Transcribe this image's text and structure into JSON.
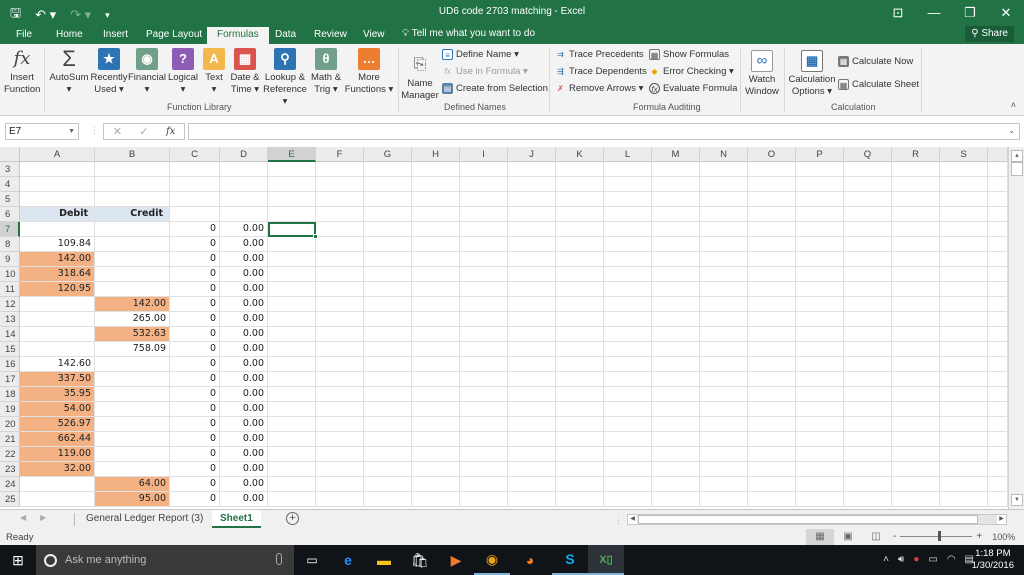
{
  "titlebar": {
    "title": "UD6 code 2703 matching - Excel",
    "save_icon": "save-icon",
    "undo_icon": "undo-icon",
    "redo_icon": "redo-icon",
    "customize_icon": "customize-qat-icon"
  },
  "tabs": [
    "File",
    "Home",
    "Insert",
    "Page Layout",
    "Formulas",
    "Data",
    "Review",
    "View"
  ],
  "active_tab": "Formulas",
  "tell_me": "Tell me what you want to do",
  "share": "Share",
  "ribbon": {
    "function_library": {
      "label": "Function Library",
      "buttons": [
        {
          "line1": "Insert",
          "line2": "Function",
          "icon": "fx-icon"
        },
        {
          "line1": "AutoSum",
          "line2": "▾",
          "icon": "sigma-icon"
        },
        {
          "line1": "Recently",
          "line2": "Used ▾",
          "icon": "star-book-icon"
        },
        {
          "line1": "Financial",
          "line2": "▾",
          "icon": "coins-book-icon"
        },
        {
          "line1": "Logical",
          "line2": "▾",
          "icon": "question-book-icon"
        },
        {
          "line1": "Text",
          "line2": "▾",
          "icon": "a-book-icon"
        },
        {
          "line1": "Date &",
          "line2": "Time ▾",
          "icon": "calendar-book-icon"
        },
        {
          "line1": "Lookup &",
          "line2": "Reference ▾",
          "icon": "magnifier-book-icon"
        },
        {
          "line1": "Math &",
          "line2": "Trig ▾",
          "icon": "theta-book-icon"
        },
        {
          "line1": "More",
          "line2": "Functions ▾",
          "icon": "ellipsis-book-icon"
        }
      ]
    },
    "defined_names": {
      "label": "Defined Names",
      "name_manager": {
        "line1": "Name",
        "line2": "Manager"
      },
      "define_name": "Define Name ▾",
      "use_in_formula": "Use in Formula ▾",
      "create_from_selection": "Create from Selection"
    },
    "formula_auditing": {
      "label": "Formula Auditing",
      "trace_precedents": "Trace Precedents",
      "trace_dependents": "Trace Dependents",
      "remove_arrows": "Remove Arrows ▾",
      "show_formulas": "Show Formulas",
      "error_checking": "Error Checking ▾",
      "evaluate_formula": "Evaluate Formula",
      "watch_window": {
        "line1": "Watch",
        "line2": "Window"
      }
    },
    "calculation": {
      "label": "Calculation",
      "options": {
        "line1": "Calculation",
        "line2": "Options ▾"
      },
      "calculate_now": "Calculate Now",
      "calculate_sheet": "Calculate Sheet"
    }
  },
  "formula_bar": {
    "name_box": "E7",
    "cancel": "✕",
    "enter": "✓",
    "fx": "fx",
    "formula": ""
  },
  "columns": [
    "A",
    "B",
    "C",
    "D",
    "E",
    "F",
    "G",
    "H",
    "I",
    "J",
    "K",
    "L",
    "M",
    "N",
    "O",
    "P",
    "Q",
    "R",
    "S"
  ],
  "selected_column": "E",
  "rows": [
    {
      "n": "3",
      "A": "",
      "B": "",
      "C": "",
      "D": ""
    },
    {
      "n": "4",
      "A": "",
      "B": "",
      "C": "",
      "D": ""
    },
    {
      "n": "5",
      "A": "",
      "B": "",
      "C": "",
      "D": ""
    },
    {
      "n": "6",
      "A": "Debit",
      "B": "Credit",
      "C": "",
      "D": "",
      "header": true
    },
    {
      "n": "7",
      "A": "",
      "B": "",
      "C": "0",
      "D": "0.00"
    },
    {
      "n": "8",
      "A": "109.84",
      "B": "",
      "C": "0",
      "D": "0.00"
    },
    {
      "n": "9",
      "A": "142.00",
      "B": "",
      "C": "0",
      "D": "0.00",
      "fillA": true
    },
    {
      "n": "10",
      "A": "318.64",
      "B": "",
      "C": "0",
      "D": "0.00",
      "fillA": true
    },
    {
      "n": "11",
      "A": "120.95",
      "B": "",
      "C": "0",
      "D": "0.00",
      "fillA": true
    },
    {
      "n": "12",
      "A": "",
      "B": "142.00",
      "C": "0",
      "D": "0.00",
      "fillB": true
    },
    {
      "n": "13",
      "A": "",
      "B": "265.00",
      "C": "0",
      "D": "0.00"
    },
    {
      "n": "14",
      "A": "",
      "B": "532.63",
      "C": "0",
      "D": "0.00",
      "fillB": true
    },
    {
      "n": "15",
      "A": "",
      "B": "758.09",
      "C": "0",
      "D": "0.00"
    },
    {
      "n": "16",
      "A": "142.60",
      "B": "",
      "C": "0",
      "D": "0.00"
    },
    {
      "n": "17",
      "A": "337.50",
      "B": "",
      "C": "0",
      "D": "0.00",
      "fillA": true
    },
    {
      "n": "18",
      "A": "35.95",
      "B": "",
      "C": "0",
      "D": "0.00",
      "fillA": true
    },
    {
      "n": "19",
      "A": "54.00",
      "B": "",
      "C": "0",
      "D": "0.00",
      "fillA": true
    },
    {
      "n": "20",
      "A": "526.97",
      "B": "",
      "C": "0",
      "D": "0.00",
      "fillA": true
    },
    {
      "n": "21",
      "A": "662.44",
      "B": "",
      "C": "0",
      "D": "0.00",
      "fillA": true
    },
    {
      "n": "22",
      "A": "119.00",
      "B": "",
      "C": "0",
      "D": "0.00",
      "fillA": true
    },
    {
      "n": "23",
      "A": "32.00",
      "B": "",
      "C": "0",
      "D": "0.00",
      "fillA": true
    },
    {
      "n": "24",
      "A": "",
      "B": "64.00",
      "C": "0",
      "D": "0.00",
      "fillB": true
    },
    {
      "n": "25",
      "A": "",
      "B": "95.00",
      "C": "0",
      "D": "0.00",
      "fillB": true
    }
  ],
  "active_cell": {
    "row": "7",
    "col": "E"
  },
  "colors": {
    "orange_fill": "#f4b183",
    "header_fill": "#dce6f1",
    "excel_green": "#217346"
  },
  "sheets": [
    "General Ledger Report (3)",
    "Sheet1"
  ],
  "active_sheet": "Sheet1",
  "status": {
    "text": "Ready",
    "zoom_percent": "100%",
    "zoom_minus": "-",
    "zoom_plus": "+"
  },
  "taskbar": {
    "search_placeholder": "Ask me anything",
    "apps": [
      "task-view",
      "edge",
      "file-explorer",
      "store",
      "media-player",
      "chrome",
      "firefox",
      "skype",
      "excel"
    ],
    "time": "1:18 PM",
    "date": "1/30/2016"
  }
}
